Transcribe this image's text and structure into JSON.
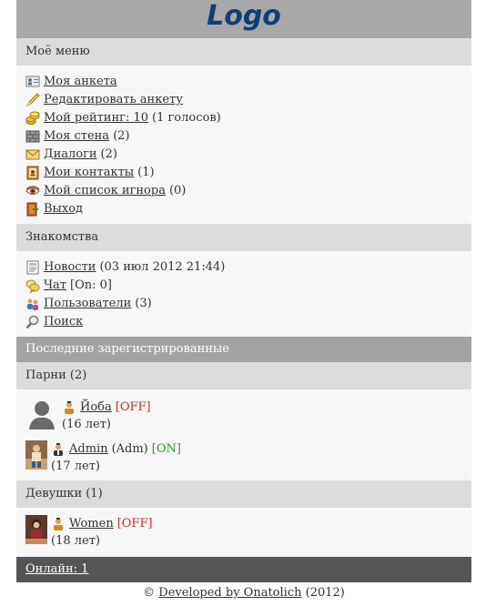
{
  "logo": "Logo",
  "my_menu": {
    "title": "Моё меню",
    "items": [
      {
        "icon": "profile-card-icon",
        "label": "Моя анкета",
        "extra": ""
      },
      {
        "icon": "pencil-icon",
        "label": "Редактировать анкету",
        "extra": ""
      },
      {
        "icon": "coins-icon",
        "label": "Мой рейтинг: 10",
        "extra": "(1 голосов)"
      },
      {
        "icon": "wall-icon",
        "label": "Моя стена",
        "extra": "(2)"
      },
      {
        "icon": "envelope-icon",
        "label": "Диалоги",
        "extra": "(2)"
      },
      {
        "icon": "address-book-icon",
        "label": "Мои контакты",
        "extra": "(1)"
      },
      {
        "icon": "eye-icon",
        "label": "Мой список игнора",
        "extra": "(0)"
      },
      {
        "icon": "exit-door-icon",
        "label": "Выход",
        "extra": ""
      }
    ]
  },
  "dating": {
    "title": "Знакомства",
    "items": [
      {
        "icon": "news-icon",
        "label": "Новости",
        "extra": "(03 июл 2012 21:44)"
      },
      {
        "icon": "chat-bubbles-icon",
        "label": "Чат",
        "extra": "[On: 0]"
      },
      {
        "icon": "users-icon",
        "label": "Пользователи",
        "extra": "(3)"
      },
      {
        "icon": "magnifier-icon",
        "label": "Поиск",
        "extra": ""
      }
    ]
  },
  "recent": {
    "title": "Последние зарегистрированные",
    "guys": {
      "title": "Парни (2)",
      "users": [
        {
          "name": "Йоба",
          "role": "",
          "status": "[OFF]",
          "age": "(16 лет)"
        },
        {
          "name": "Admin",
          "role": "(Adm)",
          "status": "[ON]",
          "age": "(17 лет)"
        }
      ]
    },
    "girls": {
      "title": "Девушки (1)",
      "users": [
        {
          "name": "Women",
          "role": "",
          "status": "[OFF]",
          "age": "(18 лет)"
        }
      ]
    }
  },
  "online": "Онлайн: 1",
  "footer": {
    "copyright": "©",
    "developer": "Developed by Onatolich",
    "year": "(2012)"
  },
  "colors": {
    "logo_text": "#0e3e75",
    "header_bg": "#a9a9a9",
    "section_bg": "#dcdcdc",
    "online_bg": "#555555",
    "status_off": "#d62a2a",
    "status_on": "#2a9a2a"
  }
}
